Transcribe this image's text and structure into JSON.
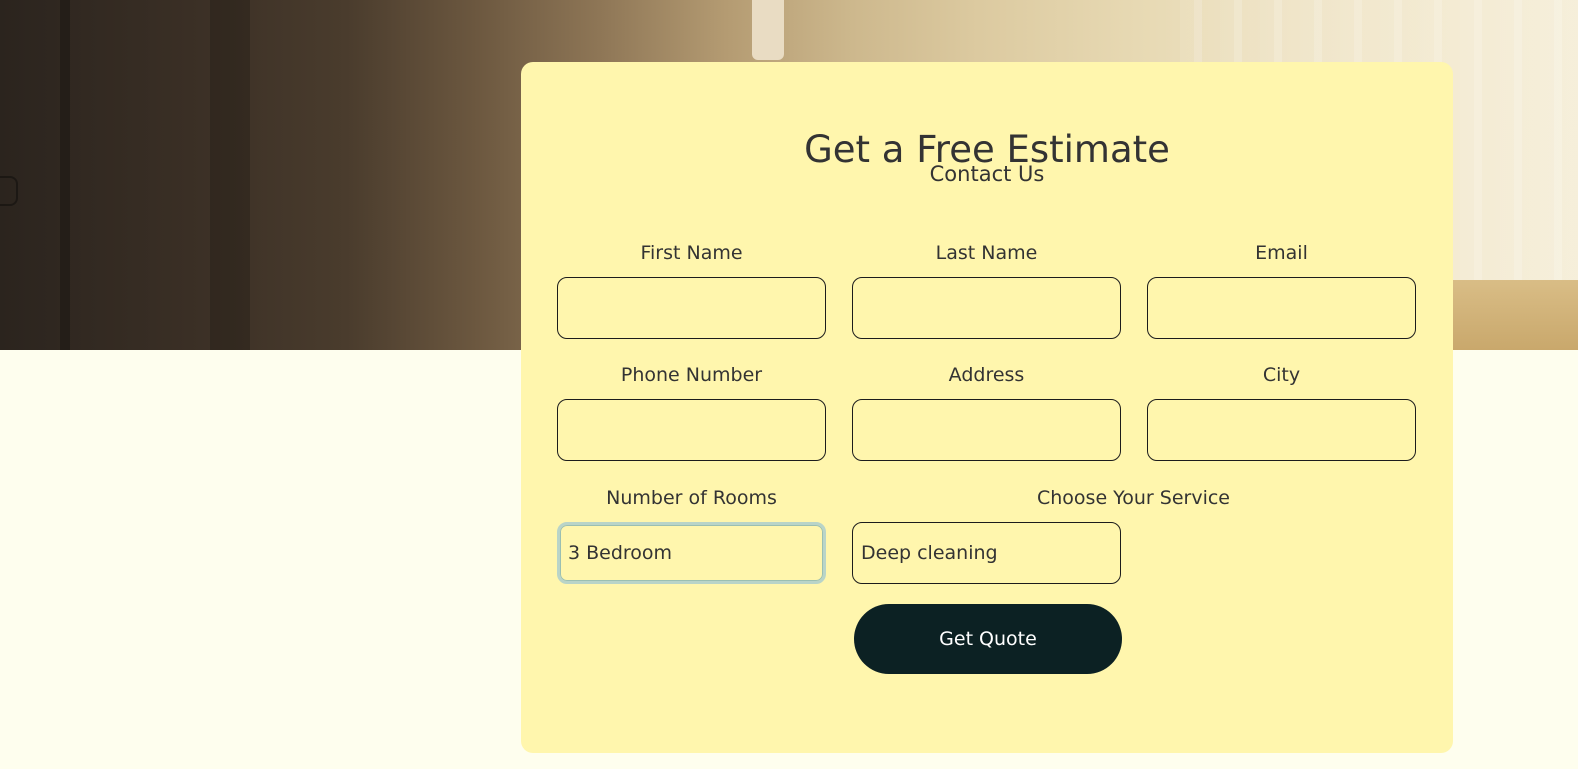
{
  "hero": {
    "image": "interior-room-with-curtains-photo"
  },
  "form": {
    "title": "Get a Free Estimate",
    "subtitle": "Contact Us",
    "fields": {
      "first_name": {
        "label": "First Name",
        "value": ""
      },
      "last_name": {
        "label": "Last Name",
        "value": ""
      },
      "email": {
        "label": "Email",
        "value": ""
      },
      "phone": {
        "label": "Phone Number",
        "value": ""
      },
      "address": {
        "label": "Address",
        "value": ""
      },
      "city": {
        "label": "City",
        "value": ""
      },
      "rooms": {
        "label": "Number of Rooms",
        "value": "3 Bedroom"
      },
      "service": {
        "label": "Choose Your Service",
        "value": "Deep cleaning"
      }
    },
    "submit_label": "Get Quote"
  },
  "colors": {
    "page_background": "#fefeee",
    "card_background": "#fff6ad",
    "button_background": "#0c2123",
    "focus_ring": "#b9d4c8"
  }
}
